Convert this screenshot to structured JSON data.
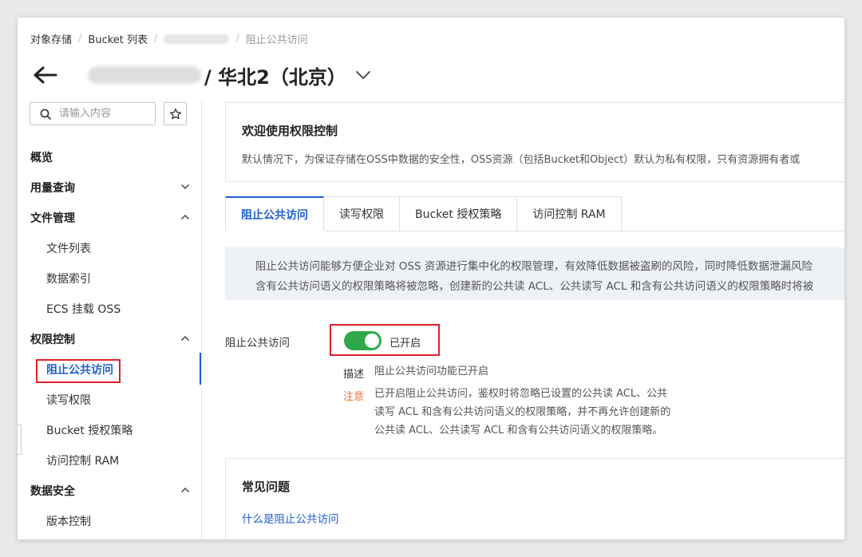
{
  "breadcrumb": {
    "items": [
      "对象存储",
      "Bucket 列表",
      "阻止公共访问"
    ]
  },
  "header": {
    "title": "/ 华北2（北京）"
  },
  "sidebar": {
    "search_placeholder": "请输入内容",
    "items": [
      {
        "label": "概览"
      },
      {
        "label": "用量查询"
      },
      {
        "label": "文件管理"
      },
      {
        "label": "文件列表"
      },
      {
        "label": "数据索引"
      },
      {
        "label": "ECS 挂载 OSS"
      },
      {
        "label": "权限控制"
      },
      {
        "label": "阻止公共访问"
      },
      {
        "label": "读写权限"
      },
      {
        "label": "Bucket 授权策略"
      },
      {
        "label": "访问控制 RAM"
      },
      {
        "label": "数据安全"
      },
      {
        "label": "版本控制"
      }
    ]
  },
  "welcome": {
    "title": "欢迎使用权限控制",
    "text": "默认情况下，为保证存储在OSS中数据的安全性，OSS资源（包括Bucket和Object）默认为私有权限，只有资源拥有者或"
  },
  "tabs": [
    {
      "label": "阻止公共访问"
    },
    {
      "label": "读写权限"
    },
    {
      "label": "Bucket 授权策略"
    },
    {
      "label": "访问控制 RAM"
    }
  ],
  "notice": {
    "line1": "阻止公共访问能够方便企业对 OSS 资源进行集中化的权限管理，有效降低数据被盗刷的风险，同时降低数据泄漏风险",
    "line2": "含有公共访问语义的权限策略将被忽略，创建新的公共读 ACL、公共读写 ACL 和含有公共访问语义的权限策略时将被"
  },
  "setting": {
    "label": "阻止公共访问",
    "toggle_on": true,
    "toggle_text": "已开启",
    "desc_key": "描述",
    "desc_value": "阻止公共访问功能已开启",
    "note_key": "注意",
    "note_lines": [
      "已开启阻止公共访问，鉴权时将忽略已设置的公共读 ACL、公共",
      "读写 ACL 和含有公共访问语义的权限策略，并不再允许创建新的",
      "公共读 ACL、公共读写 ACL 和含有公共访问语义的权限策略。"
    ]
  },
  "faq": {
    "title": "常见问题",
    "link": "什么是阻止公共访问"
  },
  "colors": {
    "accent": "#1f5fd1",
    "toggle_on": "#2fa84a",
    "highlight": "#e0202a",
    "note": "#e8743b"
  }
}
